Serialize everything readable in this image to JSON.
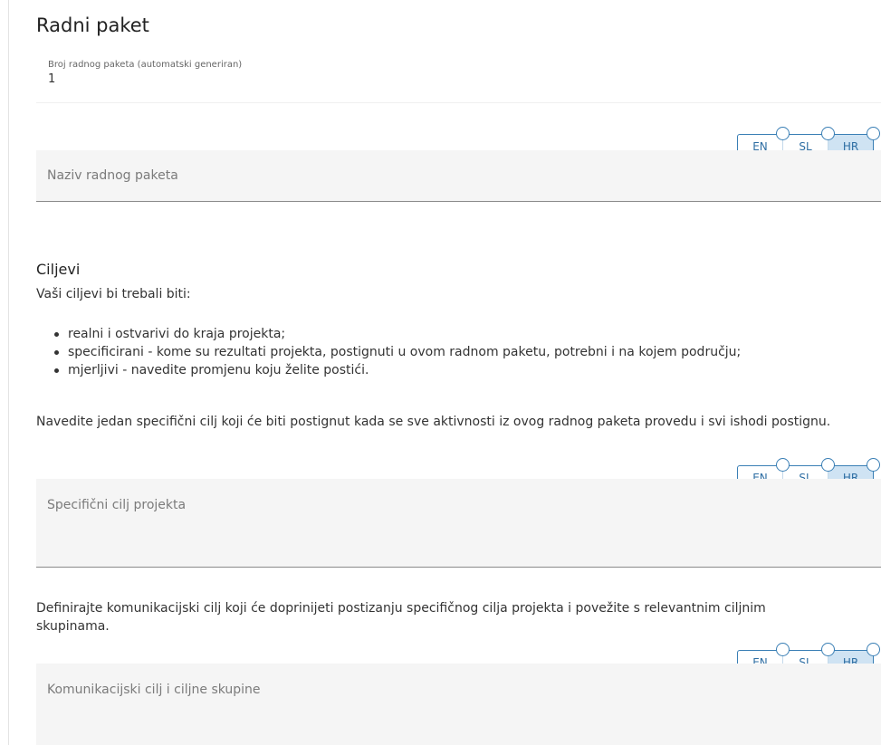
{
  "section": {
    "title": "Radni paket",
    "number_label": "Broj radnog paketa (automatski generiran)",
    "number_value": "1"
  },
  "languages": [
    "EN",
    "SL",
    "HR"
  ],
  "active_language": "HR",
  "fields": {
    "name_placeholder": "Naziv radnog paketa",
    "specific_goal_placeholder": "Specifični cilj projekta",
    "communication_goal_placeholder": "Komunikacijski cilj i ciljne skupine"
  },
  "goals": {
    "heading": "Ciljevi",
    "intro": "Vaši ciljevi bi trebali biti:",
    "bullets": [
      "realni i ostvarivi do kraja projekta;",
      "specificirani - kome su rezultati projekta, postignuti u ovom radnom paketu, potrebni i na kojem području;",
      "mjerljivi - navedite promjenu koju želite postići."
    ],
    "specific_instruction": "Navedite jedan specifični cilj koji će biti postignut kada se sve aktivnosti iz ovog radnog paketa provedu i svi ishodi postignu.",
    "communication_instruction": "Definirajte komunikacijski cilj koji će doprinijeti postizanju specifičnog cilja projekta i povežite s relevantnim ciljnim skupinama."
  },
  "colors": {
    "toggle_border": "#3a7fb5",
    "toggle_active_bg": "#cfe3f3",
    "field_bg": "#f5f5f5"
  }
}
